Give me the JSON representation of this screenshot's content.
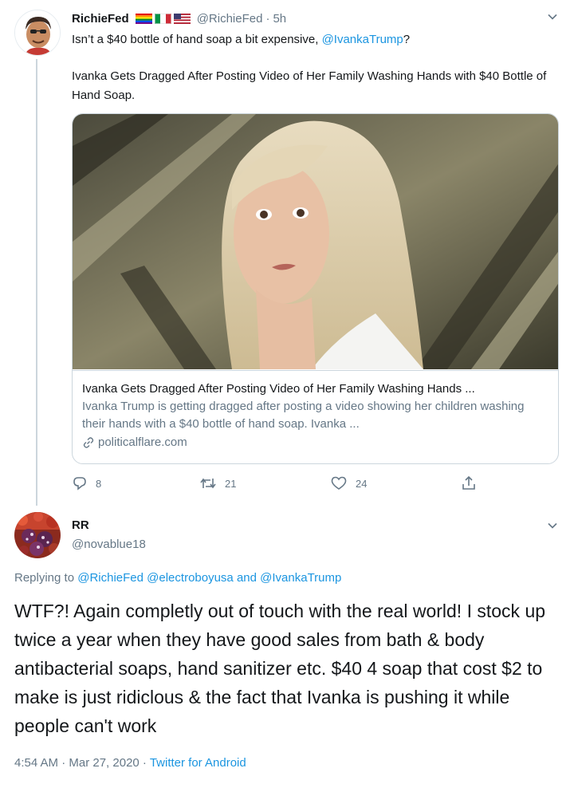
{
  "tweet1": {
    "author_name": "RichieFed",
    "handle": "@RichieFed",
    "separator": "·",
    "time": "5h",
    "text_prefix": "Isn’t a $40 bottle of hand soap a bit expensive, ",
    "mention": "@IvankaTrump",
    "text_suffix": "?",
    "headline": "Ivanka Gets Dragged After Posting Video of Her Family Washing Hands with $40 Bottle of Hand Soap.",
    "card": {
      "title": "Ivanka Gets Dragged After Posting Video of Her Family Washing Hands ...",
      "description": "Ivanka Trump is getting dragged after posting a video showing her children washing their hands with a $40 bottle of hand soap. Ivanka ...",
      "domain": "politicalflare.com"
    },
    "actions": {
      "replies": "8",
      "retweets": "21",
      "likes": "24"
    }
  },
  "tweet2": {
    "author_name": "RR",
    "handle": "@novablue18",
    "replying_label": "Replying to ",
    "reply_mentions": [
      "@RichieFed",
      "@electroboyusa",
      "@IvankaTrump"
    ],
    "reply_conjunction": " and ",
    "text": "WTF?! Again completly out of touch with the real world! I stock up twice a year when they have good sales from bath & body antibacterial soaps, hand sanitizer etc. $40 4 soap that cost $2 to make is just ridiclous & the fact that Ivanka is pushing it while people can't work",
    "timestamp": "4:54 AM · Mar 27, 2020",
    "meta_separator": " · ",
    "source": "Twitter for Android"
  },
  "icons": [
    "caret-down-icon",
    "reply-icon",
    "retweet-icon",
    "like-icon",
    "share-icon",
    "link-icon"
  ],
  "colors": {
    "link": "#1b95e0",
    "secondary_text": "#657786",
    "border": "#ccd6dd"
  }
}
